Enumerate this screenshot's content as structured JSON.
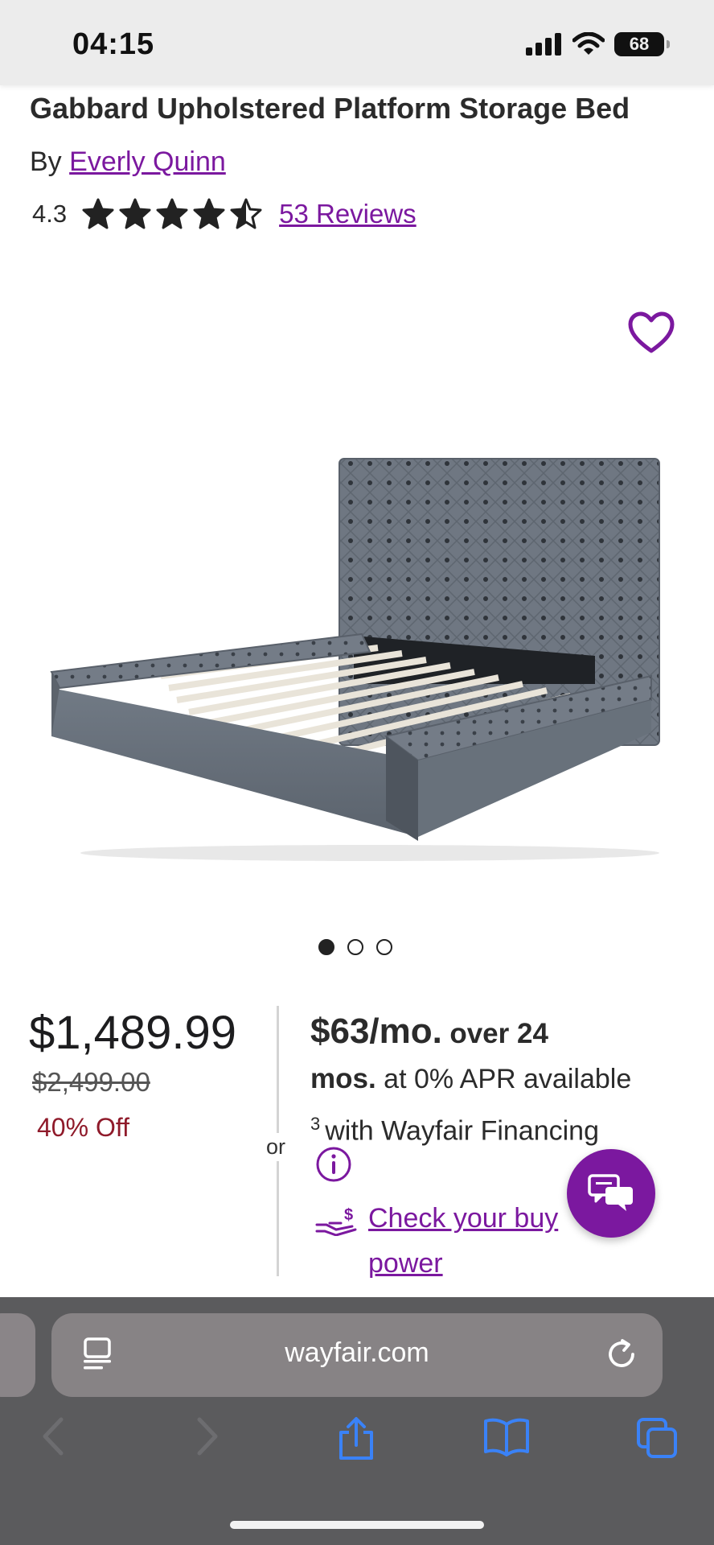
{
  "status_bar": {
    "time": "04:15",
    "battery": "68"
  },
  "product": {
    "title": "Gabbard Upholstered Platform Storage Bed",
    "by_label": "By",
    "brand": "Everly Quinn",
    "rating": "4.3",
    "rating_value": 4.3,
    "stars_max": 5,
    "reviews": "53 Reviews"
  },
  "carousel": {
    "count": 3,
    "active": 1
  },
  "pricing": {
    "price": "$1,489.99",
    "original_price": "$2,499.00",
    "discount": "40% Off",
    "or": "or"
  },
  "financing": {
    "monthly": "$63/mo.",
    "over": "over 24",
    "mos": "mos.",
    "apr": "at 0% APR available",
    "footnote": "3",
    "with": "with Wayfair Financing",
    "check_link": "Check your buy",
    "check_link_line2": "power"
  },
  "browser": {
    "url": "wayfair.com"
  },
  "colors": {
    "accent": "#7b189f",
    "discount": "#8f1a2a",
    "ios_blue": "#3a82f7"
  }
}
